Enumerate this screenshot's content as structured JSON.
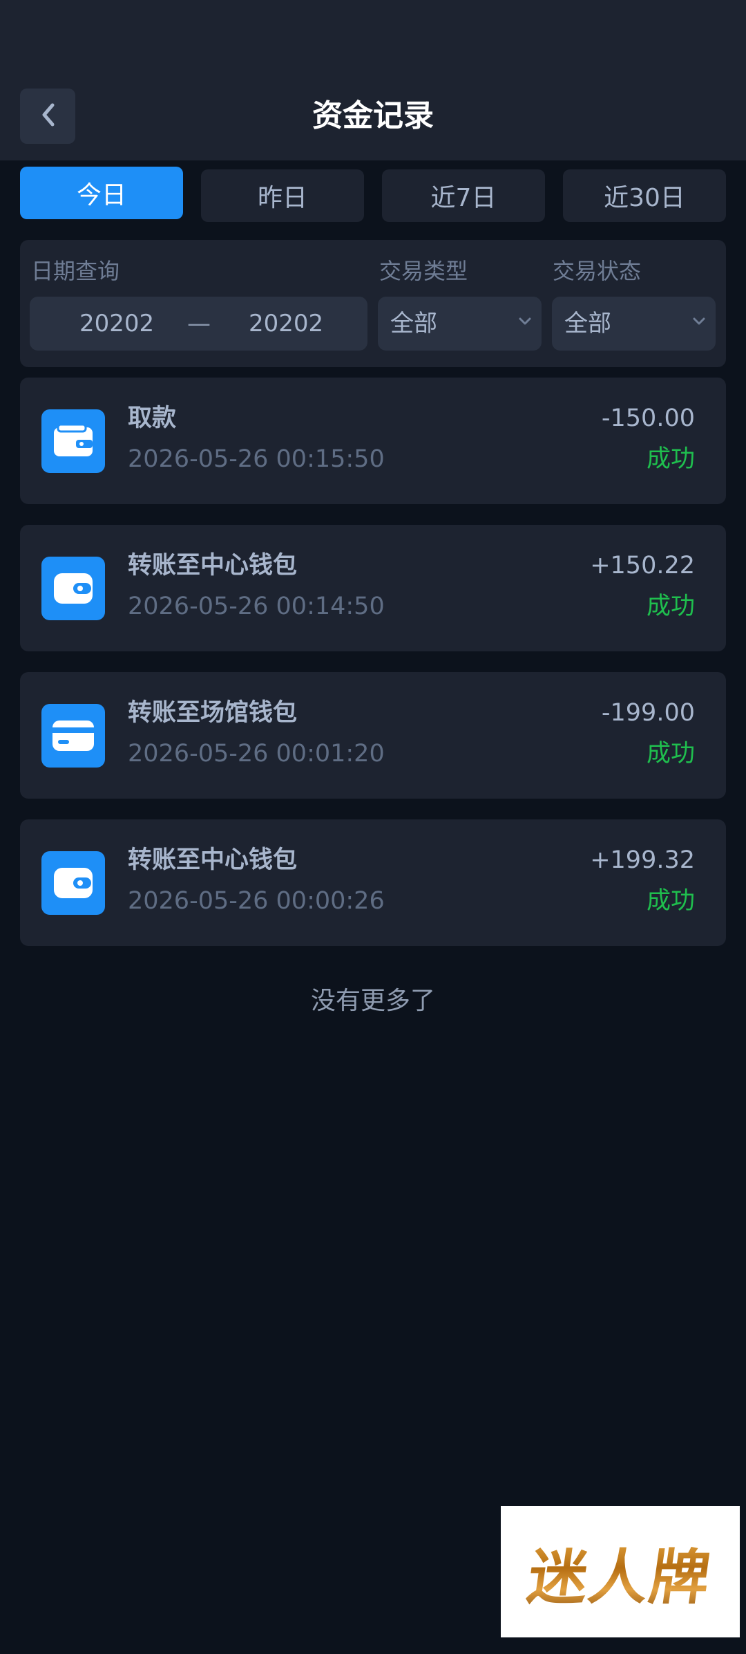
{
  "header": {
    "title": "资金记录",
    "back_icon": "chevron-left-icon"
  },
  "tabs": [
    {
      "label": "今日",
      "active": true
    },
    {
      "label": "昨日",
      "active": false
    },
    {
      "label": "近7日",
      "active": false
    },
    {
      "label": "近30日",
      "active": false
    }
  ],
  "filter": {
    "date_label": "日期查询",
    "type_label": "交易类型",
    "status_label": "交易状态",
    "date_start": "20202",
    "date_separator": "—",
    "date_end": "20202",
    "type_value": "全部",
    "status_value": "全部"
  },
  "records": [
    {
      "name": "取款",
      "time": "2026-05-26 00:15:50",
      "amount": "-150.00",
      "status": "成功",
      "icon": "wallet-icon"
    },
    {
      "name": "转账至中心钱包",
      "time": "2026-05-26 00:14:50",
      "amount": "+150.22",
      "status": "成功",
      "icon": "wallet-icon"
    },
    {
      "name": "转账至场馆钱包",
      "time": "2026-05-26 00:01:20",
      "amount": "-199.00",
      "status": "成功",
      "icon": "card-icon"
    },
    {
      "name": "转账至中心钱包",
      "time": "2026-05-26 00:00:26",
      "amount": "+199.32",
      "status": "成功",
      "icon": "wallet-icon"
    }
  ],
  "footer": {
    "no_more": "没有更多了"
  },
  "watermark": {
    "text": "迷人牌"
  },
  "colors": {
    "accent": "#1e8ff7",
    "success": "#1fbf4e",
    "background": "#0c121c",
    "panel": "#1d2330"
  }
}
